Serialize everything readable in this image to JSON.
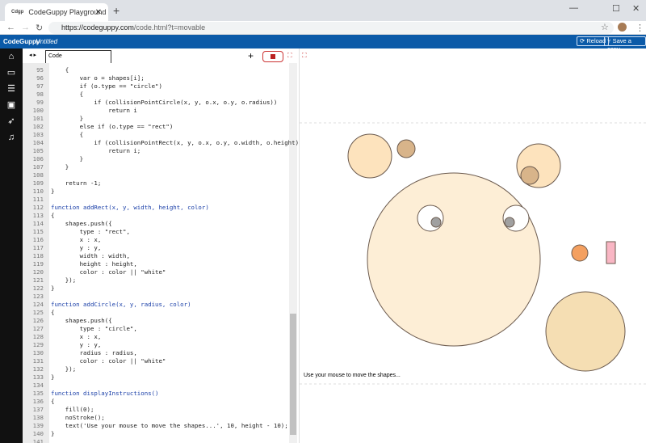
{
  "browser": {
    "tab_title": "CodeGuppy Playground",
    "favicon": "Cdgp",
    "url_host": "https://codeguppy.com",
    "url_path": "/code.html?t=movable"
  },
  "appbar": {
    "brand": "CodeGuppy",
    "doc": "Untitled",
    "reload": "⟳ Reload",
    "save": "⑂ Save a copy"
  },
  "editor": {
    "tab": "Code",
    "first_line": 95,
    "lines": [
      "    {",
      "        var o = shapes[i];",
      "        if (o.type == \"circle\")",
      "        {",
      "            if (collisionPointCircle(x, y, o.x, o.y, o.radius))",
      "                return i",
      "        }",
      "        else if (o.type == \"rect\")",
      "        {",
      "            if (collisionPointRect(x, y, o.x, o.y, o.width, o.height))",
      "                return i;",
      "        }",
      "    }",
      "",
      "    return -1;",
      "}",
      "",
      "function addRect(x, y, width, height, color)",
      "{",
      "    shapes.push({",
      "        type : \"rect\",",
      "        x : x,",
      "        y : y,",
      "        width : width,",
      "        height : height,",
      "        color : color || \"white\"",
      "    });",
      "}",
      "",
      "function addCircle(x, y, radius, color)",
      "{",
      "    shapes.push({",
      "        type : \"circle\",",
      "        x : x,",
      "        y : y,",
      "        radius : radius,",
      "        color : color || \"white\"",
      "    });",
      "}",
      "",
      "function displayInstructions()",
      "{",
      "    fill(0);",
      "    noStroke();",
      "    text('Use your mouse to move the shapes...', 10, height - 10);",
      "}",
      ""
    ]
  },
  "canvas": {
    "caption": "Use your mouse to move the shapes..."
  }
}
